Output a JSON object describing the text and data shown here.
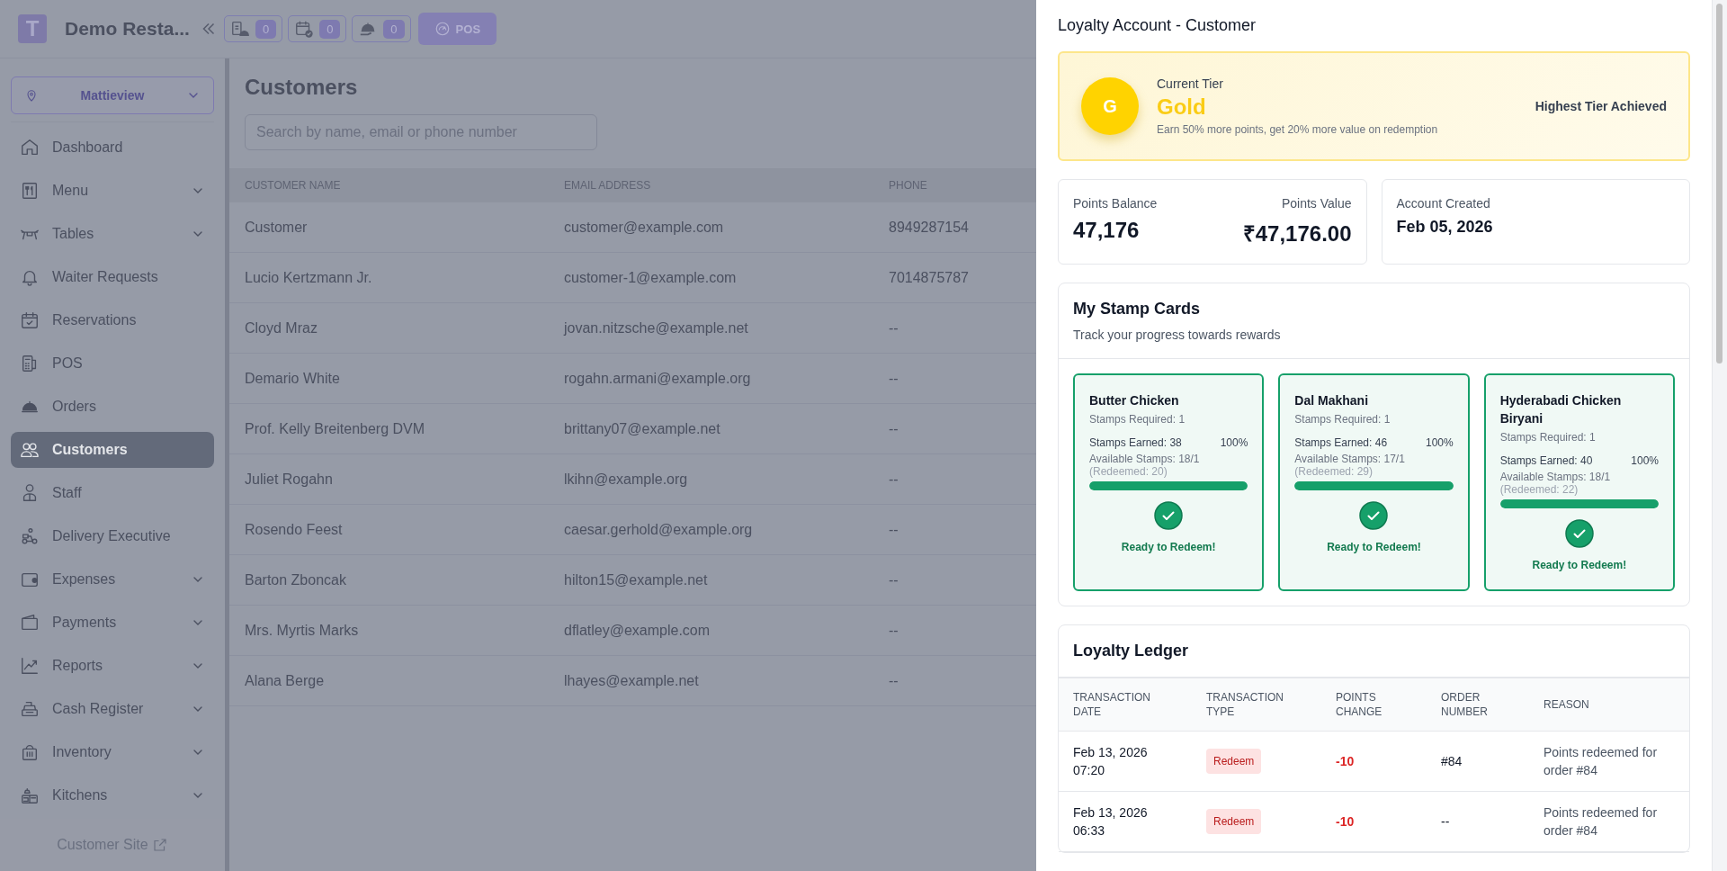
{
  "header": {
    "logo_letter": "T",
    "restaurant": "Demo Resta...",
    "counters": [
      {
        "value": "0"
      },
      {
        "value": "0"
      },
      {
        "value": "0"
      }
    ],
    "pos_button": "POS"
  },
  "sidebar": {
    "location": "Mattieview",
    "items": [
      {
        "label": "Dashboard",
        "expandable": false,
        "selected": false
      },
      {
        "label": "Menu",
        "expandable": true,
        "selected": false
      },
      {
        "label": "Tables",
        "expandable": true,
        "selected": false
      },
      {
        "label": "Waiter Requests",
        "expandable": false,
        "selected": false
      },
      {
        "label": "Reservations",
        "expandable": false,
        "selected": false
      },
      {
        "label": "POS",
        "expandable": false,
        "selected": false
      },
      {
        "label": "Orders",
        "expandable": false,
        "selected": false
      },
      {
        "label": "Customers",
        "expandable": false,
        "selected": true
      },
      {
        "label": "Staff",
        "expandable": false,
        "selected": false
      },
      {
        "label": "Delivery Executive",
        "expandable": false,
        "selected": false
      },
      {
        "label": "Expenses",
        "expandable": true,
        "selected": false
      },
      {
        "label": "Payments",
        "expandable": true,
        "selected": false
      },
      {
        "label": "Reports",
        "expandable": true,
        "selected": false
      },
      {
        "label": "Cash Register",
        "expandable": true,
        "selected": false
      },
      {
        "label": "Inventory",
        "expandable": true,
        "selected": false
      },
      {
        "label": "Kitchens",
        "expandable": true,
        "selected": false
      }
    ],
    "footer_link": "Customer Site"
  },
  "main": {
    "title": "Customers",
    "search": {
      "placeholder": "Search by name, email or phone number"
    },
    "table": {
      "columns": [
        "CUSTOMER NAME",
        "EMAIL ADDRESS",
        "PHONE"
      ],
      "rows": [
        [
          "Customer",
          "customer@example.com",
          "8949287154"
        ],
        [
          "Lucio Kertzmann Jr.",
          "customer-1@example.com",
          "7014875787"
        ],
        [
          "Cloyd Mraz",
          "jovan.nitzsche@example.net",
          "--"
        ],
        [
          "Demario White",
          "rogahn.armani@example.org",
          "--"
        ],
        [
          "Prof. Kelly Breitenberg DVM",
          "brittany07@example.net",
          "--"
        ],
        [
          "Juliet Rogahn",
          "lkihn@example.org",
          "--"
        ],
        [
          "Rosendo Feest",
          "caesar.gerhold@example.org",
          "--"
        ],
        [
          "Barton Zboncak",
          "hilton15@example.net",
          "--"
        ],
        [
          "Mrs. Myrtis Marks",
          "dflatley@example.com",
          "--"
        ],
        [
          "Alana Berge",
          "lhayes@example.net",
          "--"
        ]
      ]
    }
  },
  "panel": {
    "title": "Loyalty Account - Customer",
    "tier": {
      "badge_letter": "G",
      "label": "Current Tier",
      "name": "Gold",
      "description": "Earn 50% more points, get 20% more value on redemption",
      "status": "Highest Tier Achieved"
    },
    "points": {
      "balance_label": "Points Balance",
      "balance": "47,176",
      "value_label": "Points Value",
      "value": "₹47,176.00"
    },
    "account": {
      "label": "Account Created",
      "date": "Feb 05, 2026"
    },
    "stamp_cards": {
      "title": "My Stamp Cards",
      "subtitle": "Track your progress towards rewards",
      "cards": [
        {
          "name": "Butter Chicken",
          "required": "Stamps Required: 1",
          "earned": "Stamps Earned: 38",
          "percent": "100%",
          "available": "Available Stamps: 18/1",
          "redeemed": "(Redeemed: 20)",
          "level": 1,
          "status": "Ready to Redeem!"
        },
        {
          "name": "Dal Makhani",
          "required": "Stamps Required: 1",
          "earned": "Stamps Earned: 46",
          "percent": "100%",
          "available": "Available Stamps: 17/1",
          "redeemed": "(Redeemed: 29)",
          "level": 1,
          "status": "Ready to Redeem!"
        },
        {
          "name": "Hyderabadi Chicken Biryani",
          "required": "Stamps Required: 1",
          "earned": "Stamps Earned: 40",
          "percent": "100%",
          "available": "Available Stamps: 18/1",
          "redeemed": "(Redeemed: 22)",
          "level": 1,
          "status": "Ready to Redeem!"
        }
      ]
    },
    "ledger": {
      "title": "Loyalty Ledger",
      "columns": [
        "TRANSACTION DATE",
        "TRANSACTION TYPE",
        "POINTS CHANGE",
        "ORDER NUMBER",
        "REASON"
      ],
      "rows": [
        {
          "date": "Feb 13, 2026",
          "time": "07:20",
          "type": "Redeem",
          "kind": "redeem",
          "change": "-10",
          "order": "#84",
          "reason": "Points redeemed for order #84"
        },
        {
          "date": "Feb 13, 2026",
          "time": "06:33",
          "type": "Redeem",
          "kind": "redeem",
          "change": "-10",
          "order": "--",
          "reason": "Points redeemed for order #84"
        }
      ]
    }
  }
}
